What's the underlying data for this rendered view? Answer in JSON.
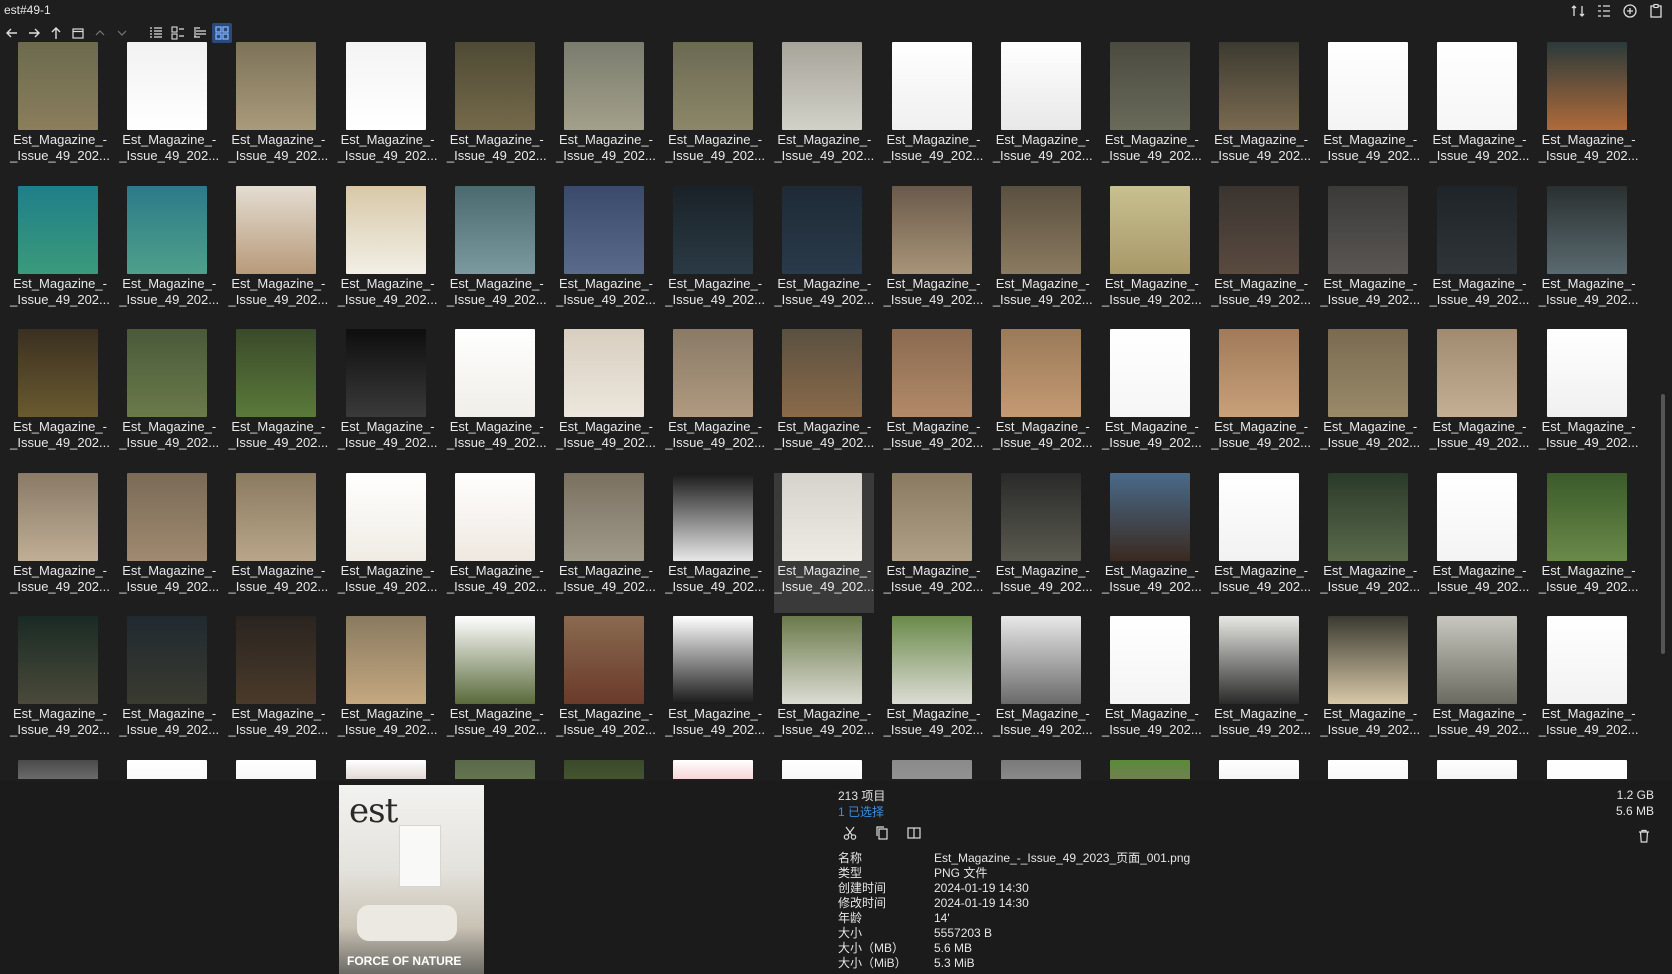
{
  "window": {
    "title": "est#49-1"
  },
  "grid": {
    "file_label_line1": "Est_Magazine_-",
    "file_label_line2": "_Issue_49_202...",
    "rows": 6,
    "cols": 15,
    "selected_index": 52
  },
  "info": {
    "item_count": "213 项目",
    "selected_count": "1 已选择",
    "total_size": "1.2 GB",
    "selected_size": "5.6 MB",
    "preview": {
      "logo": "est",
      "cover_line": "FORCE OF NATURE"
    },
    "properties": [
      {
        "key": "名称",
        "value": "Est_Magazine_-_Issue_49_2023_页面_001.png"
      },
      {
        "key": "类型",
        "value": "PNG 文件"
      },
      {
        "key": "创建时间",
        "value": "2024-01-19  14:30"
      },
      {
        "key": "修改时间",
        "value": "2024-01-19  14:30"
      },
      {
        "key": "年龄",
        "value": "14'"
      },
      {
        "key": "大小",
        "value": "5557203 B"
      },
      {
        "key": "大小（MB）",
        "value": "5.6 MB"
      },
      {
        "key": "大小（MiB）",
        "value": "5.3 MiB"
      }
    ]
  },
  "colors": {
    "background": "#1e1e1e",
    "selection": "#3a3a3a",
    "accent_blue": "#3c8ee0",
    "active_view": "#2b4a7a"
  },
  "icons": {
    "toolbar": [
      "arrow-left-icon",
      "arrow-right-icon",
      "arrow-up-icon",
      "window-icon",
      "chevron-up-icon",
      "chevron-down-icon",
      "list-view-icon",
      "details-view-icon",
      "tree-view-icon",
      "grid-view-icon"
    ],
    "top_right": [
      "sort-icon",
      "columns-icon",
      "add-icon",
      "clipboard-icon"
    ],
    "actions": [
      "cut-icon",
      "copy-icon",
      "split-icon",
      "trash-icon"
    ]
  }
}
